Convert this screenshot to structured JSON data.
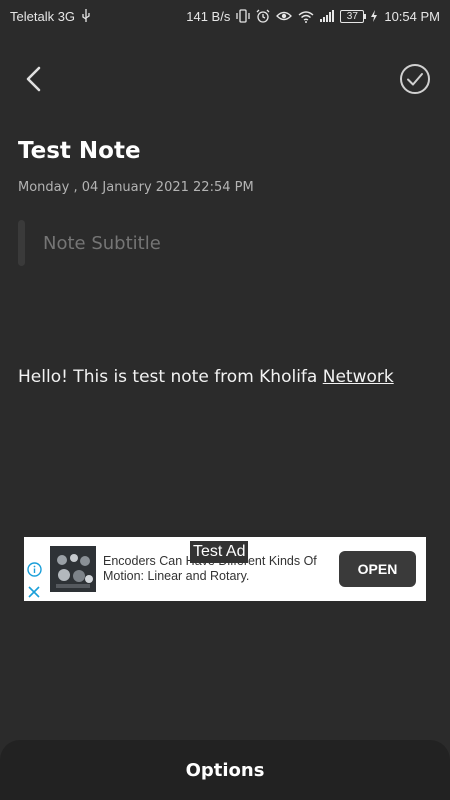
{
  "status_bar": {
    "carrier": "Teletalk 3G",
    "speed": "141 B/s",
    "battery": "37",
    "time": "10:54 PM",
    "icons": [
      "usb-icon",
      "vibrate-icon",
      "alarm-icon",
      "eye-icon",
      "wifi-icon",
      "signal-icon",
      "charging-icon"
    ]
  },
  "toolbar": {
    "back_icon": "chevron-left-icon",
    "save_icon": "check-circle-icon"
  },
  "note": {
    "title": "Test Note",
    "datetime": "Monday , 04 January 2021 22:54 PM",
    "subtitle_placeholder": "Note Subtitle",
    "body_text": "Hello! This is test note from Kholifa ",
    "body_link": "Network"
  },
  "ad": {
    "label": "Test Ad",
    "text": "Encoders Can Have Different Kinds Of Motion: Linear and Rotary.",
    "cta": "OPEN"
  },
  "options": {
    "label": "Options"
  }
}
